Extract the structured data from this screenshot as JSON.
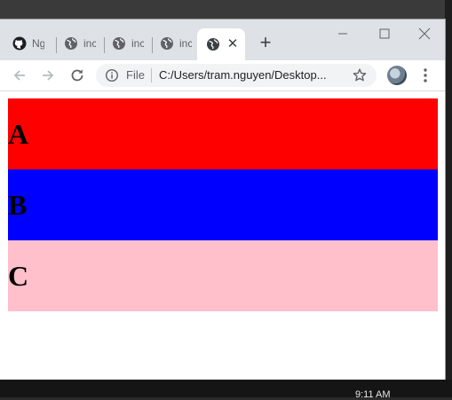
{
  "browser": {
    "tabs": [
      {
        "title": "Ng",
        "icon": "github-icon",
        "active": false
      },
      {
        "title": "inc",
        "icon": "globe-icon",
        "active": false
      },
      {
        "title": "inc",
        "icon": "globe-icon",
        "active": false
      },
      {
        "title": "inc",
        "icon": "globe-icon",
        "active": false
      },
      {
        "title": "",
        "icon": "globe-icon",
        "active": true
      }
    ],
    "address": {
      "scheme_label": "File",
      "url": "C:/Users/tram.nguyen/Desktop..."
    }
  },
  "page": {
    "bands": [
      {
        "letter": "A",
        "color": "#ff0000"
      },
      {
        "letter": "B",
        "color": "#0000ff"
      },
      {
        "letter": "C",
        "color": "#ffc0cb"
      }
    ]
  },
  "taskbar": {
    "clock": "9:11 AM"
  }
}
